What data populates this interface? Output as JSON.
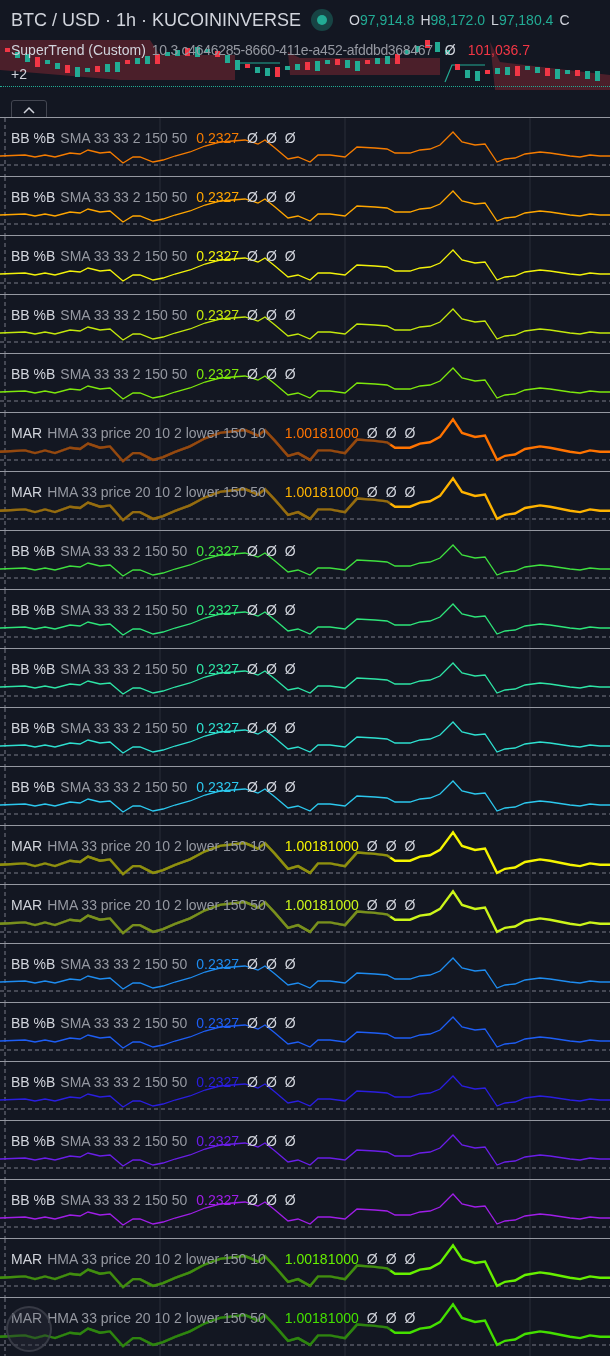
{
  "header": {
    "symbol": "BTC / USD · 1h · KUCOININVERSE",
    "ohlc": [
      {
        "label": "O",
        "value": "97,914.8"
      },
      {
        "label": "H",
        "value": "98,172.0"
      },
      {
        "label": "L",
        "value": "97,180.4"
      },
      {
        "label": "C"
      }
    ],
    "indicator": {
      "name": "SuperTrend (Custom)",
      "params": "10 3 c4646285-8660-411e-a452-afddbd368467",
      "values": [
        {
          "text": "Ø",
          "color": "#d1d4dc"
        },
        {
          "text": "101,036.7",
          "color": "#f23645"
        }
      ]
    },
    "more_indicators": "+2"
  },
  "panes": [
    {
      "kind": "bb",
      "name": "BB %B",
      "params": "SMA 33 33 2 150 50",
      "value": "0.2327",
      "color": "#f57c00",
      "extras": [
        "Ø",
        "Ø",
        "Ø"
      ]
    },
    {
      "kind": "bb",
      "name": "BB %B",
      "params": "SMA 33 33 2 150 50",
      "value": "0.2327",
      "color": "#ffa600",
      "extras": [
        "Ø",
        "Ø",
        "Ø"
      ]
    },
    {
      "kind": "bb",
      "name": "BB %B",
      "params": "SMA 33 33 2 150 50",
      "value": "0.2327",
      "color": "#f2f20a",
      "extras": [
        "Ø",
        "Ø",
        "Ø"
      ]
    },
    {
      "kind": "bb",
      "name": "BB %B",
      "params": "SMA 33 33 2 150 50",
      "value": "0.2327",
      "color": "#c4e80c",
      "extras": [
        "Ø",
        "Ø",
        "Ø"
      ]
    },
    {
      "kind": "bb",
      "name": "BB %B",
      "params": "SMA 33 33 2 150 50",
      "value": "0.2327",
      "color": "#7ee80c",
      "extras": [
        "Ø",
        "Ø",
        "Ø"
      ]
    },
    {
      "kind": "mar",
      "name": "MAR",
      "params": "HMA 33 price 20 10 2 lower 150 10",
      "value": "1.00181000",
      "color": "#ff7300",
      "extras": [
        "Ø",
        "Ø",
        "Ø"
      ]
    },
    {
      "kind": "mar",
      "name": "MAR",
      "params": "HMA 33 price 20 10 2 lower 150 50",
      "value": "1.00181000",
      "color": "#ffb300",
      "extras": [
        "Ø",
        "Ø",
        "Ø"
      ]
    },
    {
      "kind": "bb",
      "name": "BB %B",
      "params": "SMA 33 33 2 150 50",
      "value": "0.2327",
      "color": "#3fe03f",
      "extras": [
        "Ø",
        "Ø",
        "Ø"
      ]
    },
    {
      "kind": "bb",
      "name": "BB %B",
      "params": "SMA 33 33 2 150 50",
      "value": "0.2327",
      "color": "#2ee57a",
      "extras": [
        "Ø",
        "Ø",
        "Ø"
      ]
    },
    {
      "kind": "bb",
      "name": "BB %B",
      "params": "SMA 33 33 2 150 50",
      "value": "0.2327",
      "color": "#2ee5a6",
      "extras": [
        "Ø",
        "Ø",
        "Ø"
      ]
    },
    {
      "kind": "bb",
      "name": "BB %B",
      "params": "SMA 33 33 2 150 50",
      "value": "0.2327",
      "color": "#2ee0d0",
      "extras": [
        "Ø",
        "Ø",
        "Ø"
      ]
    },
    {
      "kind": "bb",
      "name": "BB %B",
      "params": "SMA 33 33 2 150 50",
      "value": "0.2327",
      "color": "#2cc8ee",
      "extras": [
        "Ø",
        "Ø",
        "Ø"
      ]
    },
    {
      "kind": "mar",
      "name": "MAR",
      "params": "HMA 33 price 20 10 2 lower 150 10",
      "value": "1.00181000",
      "color": "#f5f500",
      "extras": [
        "Ø",
        "Ø",
        "Ø"
      ]
    },
    {
      "kind": "mar",
      "name": "MAR",
      "params": "HMA 33 price 20 10 2 lower 150 50",
      "value": "1.00181000",
      "color": "#ccf51a",
      "extras": [
        "Ø",
        "Ø",
        "Ø"
      ]
    },
    {
      "kind": "bb",
      "name": "BB %B",
      "params": "SMA 33 33 2 150 50",
      "value": "0.2327",
      "color": "#1e8cf0",
      "extras": [
        "Ø",
        "Ø",
        "Ø"
      ]
    },
    {
      "kind": "bb",
      "name": "BB %B",
      "params": "SMA 33 33 2 150 50",
      "value": "0.2327",
      "color": "#1e5ef5",
      "extras": [
        "Ø",
        "Ø",
        "Ø"
      ]
    },
    {
      "kind": "bb",
      "name": "BB %B",
      "params": "SMA 33 33 2 150 50",
      "value": "0.2327",
      "color": "#2a1ee0",
      "extras": [
        "Ø",
        "Ø",
        "Ø"
      ]
    },
    {
      "kind": "bb",
      "name": "BB %B",
      "params": "SMA 33 33 2 150 50",
      "value": "0.2327",
      "color": "#6a1ee8",
      "extras": [
        "Ø",
        "Ø",
        "Ø"
      ]
    },
    {
      "kind": "bb",
      "name": "BB %B",
      "params": "SMA 33 33 2 150 50",
      "value": "0.2327",
      "color": "#a01ee8",
      "extras": [
        "Ø",
        "Ø",
        "Ø"
      ]
    },
    {
      "kind": "mar",
      "name": "MAR",
      "params": "HMA 33 price 20 10 2 lower 150 10",
      "value": "1.00181000",
      "color": "#66f000",
      "extras": [
        "Ø",
        "Ø",
        "Ø"
      ]
    },
    {
      "kind": "mar",
      "name": "MAR",
      "params": "HMA 33 price 20 10 2 lower 150 50",
      "value": "1.00181000",
      "color": "#44e000",
      "extras": [
        "Ø",
        "Ø",
        "Ø"
      ]
    }
  ]
}
